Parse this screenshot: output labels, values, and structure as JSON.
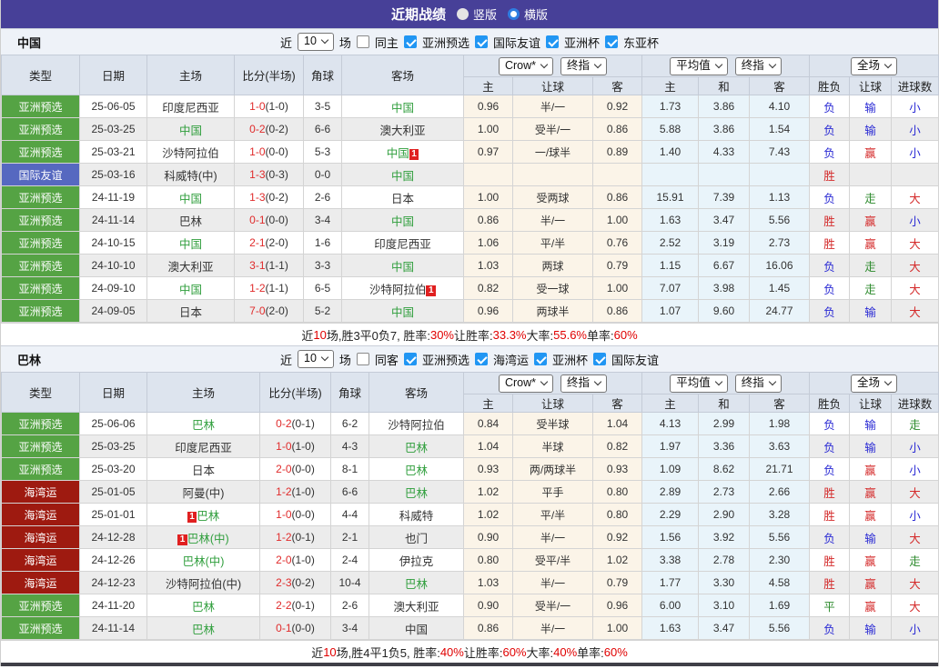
{
  "title_bar": {
    "title": "近期战绩",
    "layout_options": [
      {
        "label": "竖版",
        "selected": false
      },
      {
        "label": "横版",
        "selected": true
      }
    ]
  },
  "column_headers": {
    "main": [
      "类型",
      "日期",
      "主场",
      "比分(半场)",
      "角球",
      "客场"
    ],
    "odds_group": {
      "source": "Crow*",
      "stage": "终指",
      "cols": [
        "主",
        "让球",
        "客"
      ]
    },
    "avg_group": {
      "source": "平均值",
      "stage": "终指",
      "cols": [
        "主",
        "和",
        "客"
      ]
    },
    "full_group": {
      "source": "全场",
      "cols": [
        "胜负",
        "让球",
        "进球数"
      ]
    }
  },
  "type_colors": {
    "亚洲预选": "#55a344",
    "国际友谊": "#5668c0",
    "海湾运": "#9e1a10"
  },
  "result_colors": {
    "red": "#d42a2a",
    "blue": "#2a2ad4",
    "green": "#2e8b2e"
  },
  "team_highlight_color": "#2f9e3c",
  "tables": [
    {
      "team": "中国",
      "filter": {
        "prefix": "近",
        "count": "10",
        "suffix": "场",
        "same_side": {
          "label": "同主",
          "checked": false
        },
        "competitions": [
          {
            "label": "亚洲预选",
            "checked": true
          },
          {
            "label": "国际友谊",
            "checked": true
          },
          {
            "label": "亚洲杯",
            "checked": true
          },
          {
            "label": "东亚杯",
            "checked": true
          }
        ]
      },
      "rows": [
        {
          "type": "亚洲预选",
          "date": "25-06-05",
          "home": {
            "name": "印度尼西亚"
          },
          "score": "1-0",
          "half": "(1-0)",
          "corners": "3-5",
          "away": {
            "name": "中国",
            "highlight": true
          },
          "odds": [
            "0.96",
            "半/一",
            "0.92"
          ],
          "avg": [
            "1.73",
            "3.86",
            "4.10"
          ],
          "results": [
            {
              "text": "负",
              "color": "blue"
            },
            {
              "text": "输",
              "color": "blue"
            },
            {
              "text": "小",
              "color": "blue"
            }
          ]
        },
        {
          "type": "亚洲预选",
          "date": "25-03-25",
          "home": {
            "name": "中国",
            "highlight": true
          },
          "score": "0-2",
          "half": "(0-2)",
          "corners": "6-6",
          "away": {
            "name": "澳大利亚"
          },
          "odds": [
            "1.00",
            "受半/一",
            "0.86"
          ],
          "avg": [
            "5.88",
            "3.86",
            "1.54"
          ],
          "results": [
            {
              "text": "负",
              "color": "blue"
            },
            {
              "text": "输",
              "color": "blue"
            },
            {
              "text": "小",
              "color": "blue"
            }
          ]
        },
        {
          "type": "亚洲预选",
          "date": "25-03-21",
          "home": {
            "name": "沙特阿拉伯"
          },
          "score": "1-0",
          "half": "(0-0)",
          "corners": "5-3",
          "away": {
            "name": "中国",
            "highlight": true,
            "card": "1",
            "card_pos": "after"
          },
          "odds": [
            "0.97",
            "一/球半",
            "0.89"
          ],
          "avg": [
            "1.40",
            "4.33",
            "7.43"
          ],
          "results": [
            {
              "text": "负",
              "color": "blue"
            },
            {
              "text": "赢",
              "color": "red"
            },
            {
              "text": "小",
              "color": "blue"
            }
          ]
        },
        {
          "type": "国际友谊",
          "date": "25-03-16",
          "home": {
            "name": "科威特(中)"
          },
          "score": "1-3",
          "half": "(0-3)",
          "corners": "0-0",
          "away": {
            "name": "中国",
            "highlight": true
          },
          "odds": [
            "",
            "",
            ""
          ],
          "avg": [
            "",
            "",
            ""
          ],
          "results": [
            {
              "text": "胜",
              "color": "red"
            },
            {
              "text": "",
              "color": "red"
            },
            {
              "text": "",
              "color": "red"
            }
          ]
        },
        {
          "type": "亚洲预选",
          "date": "24-11-19",
          "home": {
            "name": "中国",
            "highlight": true
          },
          "score": "1-3",
          "half": "(0-2)",
          "corners": "2-6",
          "away": {
            "name": "日本"
          },
          "odds": [
            "1.00",
            "受两球",
            "0.86"
          ],
          "avg": [
            "15.91",
            "7.39",
            "1.13"
          ],
          "results": [
            {
              "text": "负",
              "color": "blue"
            },
            {
              "text": "走",
              "color": "green"
            },
            {
              "text": "大",
              "color": "red"
            }
          ]
        },
        {
          "type": "亚洲预选",
          "date": "24-11-14",
          "home": {
            "name": "巴林"
          },
          "score": "0-1",
          "half": "(0-0)",
          "corners": "3-4",
          "away": {
            "name": "中国",
            "highlight": true
          },
          "odds": [
            "0.86",
            "半/一",
            "1.00"
          ],
          "avg": [
            "1.63",
            "3.47",
            "5.56"
          ],
          "results": [
            {
              "text": "胜",
              "color": "red"
            },
            {
              "text": "赢",
              "color": "red"
            },
            {
              "text": "小",
              "color": "blue"
            }
          ]
        },
        {
          "type": "亚洲预选",
          "date": "24-10-15",
          "home": {
            "name": "中国",
            "highlight": true
          },
          "score": "2-1",
          "half": "(2-0)",
          "corners": "1-6",
          "away": {
            "name": "印度尼西亚"
          },
          "odds": [
            "1.06",
            "平/半",
            "0.76"
          ],
          "avg": [
            "2.52",
            "3.19",
            "2.73"
          ],
          "results": [
            {
              "text": "胜",
              "color": "red"
            },
            {
              "text": "赢",
              "color": "red"
            },
            {
              "text": "大",
              "color": "red"
            }
          ]
        },
        {
          "type": "亚洲预选",
          "date": "24-10-10",
          "home": {
            "name": "澳大利亚"
          },
          "score": "3-1",
          "half": "(1-1)",
          "corners": "3-3",
          "away": {
            "name": "中国",
            "highlight": true
          },
          "odds": [
            "1.03",
            "两球",
            "0.79"
          ],
          "avg": [
            "1.15",
            "6.67",
            "16.06"
          ],
          "results": [
            {
              "text": "负",
              "color": "blue"
            },
            {
              "text": "走",
              "color": "green"
            },
            {
              "text": "大",
              "color": "red"
            }
          ]
        },
        {
          "type": "亚洲预选",
          "date": "24-09-10",
          "home": {
            "name": "中国",
            "highlight": true
          },
          "score": "1-2",
          "half": "(1-1)",
          "corners": "6-5",
          "away": {
            "name": "沙特阿拉伯",
            "card": "1",
            "card_pos": "after"
          },
          "odds": [
            "0.82",
            "受一球",
            "1.00"
          ],
          "avg": [
            "7.07",
            "3.98",
            "1.45"
          ],
          "results": [
            {
              "text": "负",
              "color": "blue"
            },
            {
              "text": "走",
              "color": "green"
            },
            {
              "text": "大",
              "color": "red"
            }
          ]
        },
        {
          "type": "亚洲预选",
          "date": "24-09-05",
          "home": {
            "name": "日本"
          },
          "score": "7-0",
          "half": "(2-0)",
          "corners": "5-2",
          "away": {
            "name": "中国",
            "highlight": true
          },
          "odds": [
            "0.96",
            "两球半",
            "0.86"
          ],
          "avg": [
            "1.07",
            "9.60",
            "24.77"
          ],
          "results": [
            {
              "text": "负",
              "color": "blue"
            },
            {
              "text": "输",
              "color": "blue"
            },
            {
              "text": "大",
              "color": "red"
            }
          ]
        }
      ],
      "summary": [
        {
          "text": "近"
        },
        {
          "text": "10",
          "red": true
        },
        {
          "text": "场,胜3平0负7, 胜率:"
        },
        {
          "text": "30%",
          "red": true
        },
        {
          "text": " 让胜率:"
        },
        {
          "text": "33.3%",
          "red": true
        },
        {
          "text": " 大率:"
        },
        {
          "text": "55.6%",
          "red": true
        },
        {
          "text": " 单率:"
        },
        {
          "text": "60%",
          "red": true
        }
      ]
    },
    {
      "team": "巴林",
      "filter": {
        "prefix": "近",
        "count": "10",
        "suffix": "场",
        "same_side": {
          "label": "同客",
          "checked": false
        },
        "competitions": [
          {
            "label": "亚洲预选",
            "checked": true
          },
          {
            "label": "海湾运",
            "checked": true
          },
          {
            "label": "亚洲杯",
            "checked": true
          },
          {
            "label": "国际友谊",
            "checked": true
          }
        ]
      },
      "rows": [
        {
          "type": "亚洲预选",
          "date": "25-06-06",
          "home": {
            "name": "巴林",
            "highlight": true
          },
          "score": "0-2",
          "half": "(0-1)",
          "corners": "6-2",
          "away": {
            "name": "沙特阿拉伯"
          },
          "odds": [
            "0.84",
            "受半球",
            "1.04"
          ],
          "avg": [
            "4.13",
            "2.99",
            "1.98"
          ],
          "results": [
            {
              "text": "负",
              "color": "blue"
            },
            {
              "text": "输",
              "color": "blue"
            },
            {
              "text": "走",
              "color": "green"
            }
          ]
        },
        {
          "type": "亚洲预选",
          "date": "25-03-25",
          "home": {
            "name": "印度尼西亚"
          },
          "score": "1-0",
          "half": "(1-0)",
          "corners": "4-3",
          "away": {
            "name": "巴林",
            "highlight": true
          },
          "odds": [
            "1.04",
            "半球",
            "0.82"
          ],
          "avg": [
            "1.97",
            "3.36",
            "3.63"
          ],
          "results": [
            {
              "text": "负",
              "color": "blue"
            },
            {
              "text": "输",
              "color": "blue"
            },
            {
              "text": "小",
              "color": "blue"
            }
          ]
        },
        {
          "type": "亚洲预选",
          "date": "25-03-20",
          "home": {
            "name": "日本"
          },
          "score": "2-0",
          "half": "(0-0)",
          "corners": "8-1",
          "away": {
            "name": "巴林",
            "highlight": true
          },
          "odds": [
            "0.93",
            "两/两球半",
            "0.93"
          ],
          "avg": [
            "1.09",
            "8.62",
            "21.71"
          ],
          "results": [
            {
              "text": "负",
              "color": "blue"
            },
            {
              "text": "赢",
              "color": "red"
            },
            {
              "text": "小",
              "color": "blue"
            }
          ]
        },
        {
          "type": "海湾运",
          "date": "25-01-05",
          "home": {
            "name": "阿曼(中)"
          },
          "score": "1-2",
          "half": "(1-0)",
          "corners": "6-6",
          "away": {
            "name": "巴林",
            "highlight": true
          },
          "odds": [
            "1.02",
            "平手",
            "0.80"
          ],
          "avg": [
            "2.89",
            "2.73",
            "2.66"
          ],
          "results": [
            {
              "text": "胜",
              "color": "red"
            },
            {
              "text": "赢",
              "color": "red"
            },
            {
              "text": "大",
              "color": "red"
            }
          ]
        },
        {
          "type": "海湾运",
          "date": "25-01-01",
          "home": {
            "name": "巴林",
            "highlight": true,
            "card": "1",
            "card_pos": "before"
          },
          "score": "1-0",
          "half": "(0-0)",
          "corners": "4-4",
          "away": {
            "name": "科威特"
          },
          "odds": [
            "1.02",
            "平/半",
            "0.80"
          ],
          "avg": [
            "2.29",
            "2.90",
            "3.28"
          ],
          "results": [
            {
              "text": "胜",
              "color": "red"
            },
            {
              "text": "赢",
              "color": "red"
            },
            {
              "text": "小",
              "color": "blue"
            }
          ]
        },
        {
          "type": "海湾运",
          "date": "24-12-28",
          "home": {
            "name": "巴林(中)",
            "highlight": true,
            "card": "1",
            "card_pos": "before"
          },
          "score": "1-2",
          "half": "(0-1)",
          "corners": "2-1",
          "away": {
            "name": "也门"
          },
          "odds": [
            "0.90",
            "半/一",
            "0.92"
          ],
          "avg": [
            "1.56",
            "3.92",
            "5.56"
          ],
          "results": [
            {
              "text": "负",
              "color": "blue"
            },
            {
              "text": "输",
              "color": "blue"
            },
            {
              "text": "大",
              "color": "red"
            }
          ]
        },
        {
          "type": "海湾运",
          "date": "24-12-26",
          "home": {
            "name": "巴林(中)",
            "highlight": true
          },
          "score": "2-0",
          "half": "(1-0)",
          "corners": "2-4",
          "away": {
            "name": "伊拉克"
          },
          "odds": [
            "0.80",
            "受平/半",
            "1.02"
          ],
          "avg": [
            "3.38",
            "2.78",
            "2.30"
          ],
          "results": [
            {
              "text": "胜",
              "color": "red"
            },
            {
              "text": "赢",
              "color": "red"
            },
            {
              "text": "走",
              "color": "green"
            }
          ]
        },
        {
          "type": "海湾运",
          "date": "24-12-23",
          "home": {
            "name": "沙特阿拉伯(中)"
          },
          "score": "2-3",
          "half": "(0-2)",
          "corners": "10-4",
          "away": {
            "name": "巴林",
            "highlight": true
          },
          "odds": [
            "1.03",
            "半/一",
            "0.79"
          ],
          "avg": [
            "1.77",
            "3.30",
            "4.58"
          ],
          "results": [
            {
              "text": "胜",
              "color": "red"
            },
            {
              "text": "赢",
              "color": "red"
            },
            {
              "text": "大",
              "color": "red"
            }
          ]
        },
        {
          "type": "亚洲预选",
          "date": "24-11-20",
          "home": {
            "name": "巴林",
            "highlight": true
          },
          "score": "2-2",
          "half": "(0-1)",
          "corners": "2-6",
          "away": {
            "name": "澳大利亚"
          },
          "odds": [
            "0.90",
            "受半/一",
            "0.96"
          ],
          "avg": [
            "6.00",
            "3.10",
            "1.69"
          ],
          "results": [
            {
              "text": "平",
              "color": "green"
            },
            {
              "text": "赢",
              "color": "red"
            },
            {
              "text": "大",
              "color": "red"
            }
          ]
        },
        {
          "type": "亚洲预选",
          "date": "24-11-14",
          "home": {
            "name": "巴林",
            "highlight": true
          },
          "score": "0-1",
          "half": "(0-0)",
          "corners": "3-4",
          "away": {
            "name": "中国"
          },
          "odds": [
            "0.86",
            "半/一",
            "1.00"
          ],
          "avg": [
            "1.63",
            "3.47",
            "5.56"
          ],
          "results": [
            {
              "text": "负",
              "color": "blue"
            },
            {
              "text": "输",
              "color": "blue"
            },
            {
              "text": "小",
              "color": "blue"
            }
          ]
        }
      ],
      "summary": [
        {
          "text": "近"
        },
        {
          "text": "10",
          "red": true
        },
        {
          "text": "场,胜4平1负5, 胜率:"
        },
        {
          "text": "40%",
          "red": true
        },
        {
          "text": " 让胜率:"
        },
        {
          "text": "60%",
          "red": true
        },
        {
          "text": " 大率:"
        },
        {
          "text": "40%",
          "red": true
        },
        {
          "text": " 单率:"
        },
        {
          "text": "60%",
          "red": true
        }
      ]
    }
  ]
}
